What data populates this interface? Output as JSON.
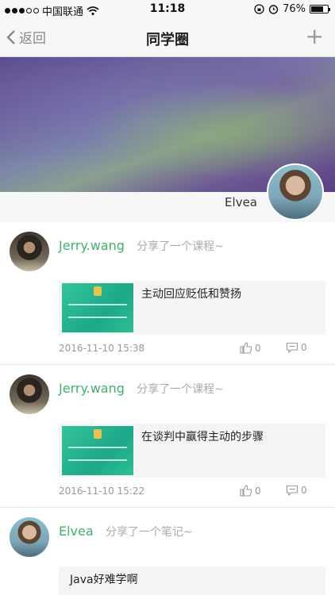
{
  "status_bar": {
    "carrier": "中国联通",
    "time": "11:18",
    "battery": "76%",
    "battery_level": 0.76
  },
  "nav": {
    "back_label": "返回",
    "title": "同学圈",
    "add_label": "+"
  },
  "profile": {
    "name": "Elvea"
  },
  "feed": [
    {
      "author": "Jerry.wang",
      "action": "分享了一个课程~",
      "title": "主动回应贬低和赞扬",
      "time": "2016-11-10 15:38",
      "likes": "0",
      "comments": "0"
    },
    {
      "author": "Jerry.wang",
      "action": "分享了一个课程~",
      "title": "在谈判中赢得主动的步骤",
      "time": "2016-11-10 15:22",
      "likes": "0",
      "comments": "0"
    },
    {
      "author": "Elvea",
      "action": "分享了一个笔记~",
      "text": "Java好难学啊"
    }
  ],
  "colors": {
    "author": "#3db36b",
    "muted": "#aaaaaa",
    "thumb": "#2dbf92"
  },
  "icons": [
    "wifi-icon",
    "orientation-lock-icon",
    "alarm-icon",
    "back-chevron-icon",
    "like-icon",
    "comment-icon"
  ]
}
